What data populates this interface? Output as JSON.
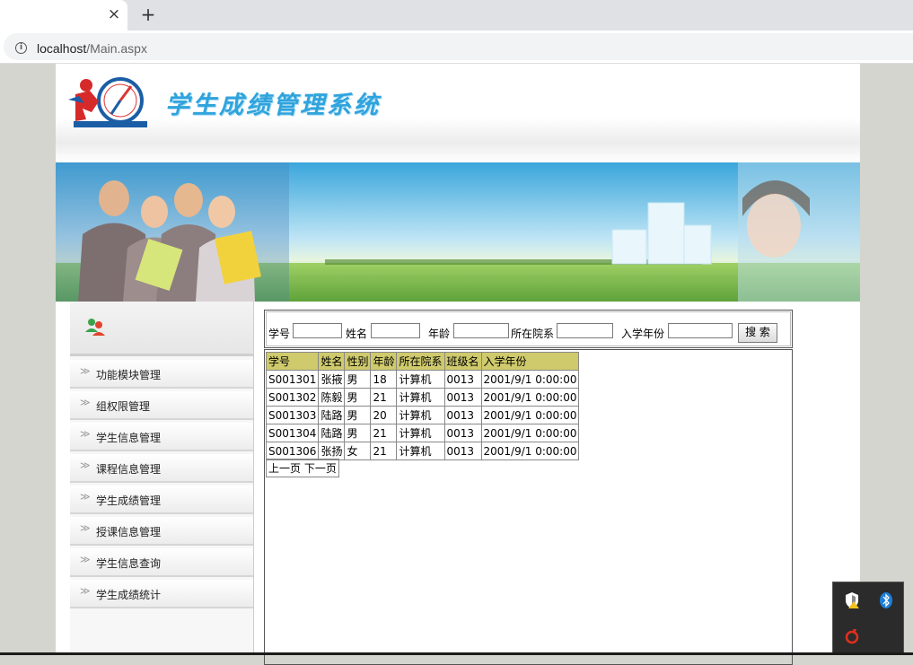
{
  "browser": {
    "tab_close": "×",
    "new_tab": "+",
    "url_host": "localhost",
    "url_path": "/Main.aspx"
  },
  "header": {
    "system_title": "学生成绩管理系统"
  },
  "sidebar": {
    "items": [
      {
        "label": "功能模块管理"
      },
      {
        "label": "组权限管理"
      },
      {
        "label": "学生信息管理"
      },
      {
        "label": "课程信息管理"
      },
      {
        "label": "学生成绩管理"
      },
      {
        "label": "授课信息管理"
      },
      {
        "label": "学生信息查询"
      },
      {
        "label": "学生成绩统计"
      }
    ]
  },
  "search": {
    "student_id_label": "学号",
    "student_id_value": "",
    "name_label": "姓名",
    "name_value": "",
    "age_label": "年龄",
    "age_value": "",
    "dept_label": "所在院系",
    "dept_value": "",
    "year_label": "入学年份",
    "year_value": "",
    "search_button": "搜 索"
  },
  "table": {
    "headers": [
      "学号",
      "姓名",
      "性别",
      "年龄",
      "所在院系",
      "班级名",
      "入学年份"
    ],
    "rows": [
      [
        "S001301",
        "张掖",
        "男",
        "18",
        "计算机",
        "0013",
        "2001/9/1 0:00:00"
      ],
      [
        "S001302",
        "陈毅",
        "男",
        "21",
        "计算机",
        "0013",
        "2001/9/1 0:00:00"
      ],
      [
        "S001303",
        "陆路",
        "男",
        "20",
        "计算机",
        "0013",
        "2001/9/1 0:00:00"
      ],
      [
        "S001304",
        "陆路",
        "男",
        "21",
        "计算机",
        "0013",
        "2001/9/1 0:00:00"
      ],
      [
        "S001306",
        "张扬",
        "女",
        "21",
        "计算机",
        "0013",
        "2001/9/1 0:00:00"
      ]
    ]
  },
  "pager": {
    "prev": "上一页",
    "next": "下一页"
  },
  "tray": {
    "icons": [
      "security-warning-icon",
      "bluetooth-icon",
      "app-red-icon"
    ]
  },
  "colors": {
    "title_blue": "#2fa3dc",
    "table_header": "#cfca6c"
  }
}
